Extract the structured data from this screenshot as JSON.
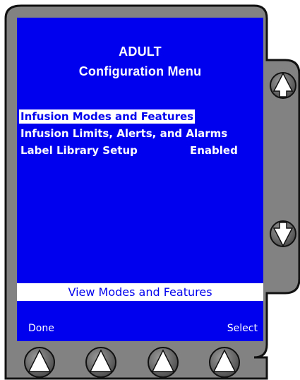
{
  "screen": {
    "title_line1": "ADULT",
    "title_line2": "Configuration Menu",
    "menu": {
      "items": [
        {
          "label": "Infusion Modes and Features",
          "selected": true
        },
        {
          "label": "Infusion Limits, Alerts, and Alarms",
          "selected": false
        },
        {
          "label": "Label Library Setup",
          "status": "Enabled",
          "selected": false
        }
      ]
    },
    "status_bar": "View Modes and Features",
    "softkeys": {
      "left": "Done",
      "right": "Select"
    }
  },
  "hardware": {
    "side_buttons": [
      {
        "name": "up",
        "icon": "up-arrow-icon"
      },
      {
        "name": "down",
        "icon": "down-arrow-icon"
      }
    ],
    "bottom_buttons_icon": "up-arrow-icon",
    "bottom_buttons_count": 4
  },
  "colors": {
    "bezel": "#828282",
    "screen": "#0000ee",
    "text": "#ffffff",
    "highlight_bg": "#ffffff",
    "highlight_text": "#0000ee"
  }
}
